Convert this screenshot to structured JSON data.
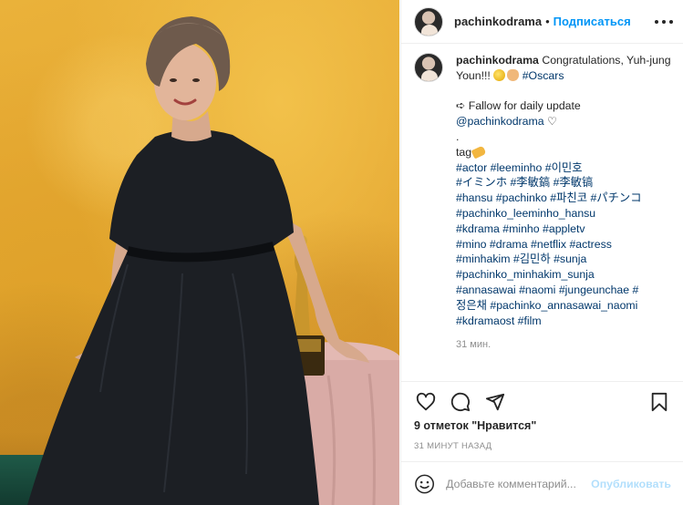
{
  "post": {
    "username": "pachinkodrama",
    "follow_label": "Подписаться",
    "header_separator": "•"
  },
  "caption": {
    "username": "pachinkodrama",
    "text_lead": "Congratulations, Yuh-jung Youn!!!",
    "oscars_tag": "#Oscars",
    "follow_line": "➪ Fallow for daily update",
    "mention": "@pachinkodrama",
    "heart": "♡",
    "dot_line": ".",
    "tag_word": "tag",
    "hashtag_lines": [
      [
        "#actor",
        "#leeminho",
        "#이민호"
      ],
      [
        "#イミンホ",
        "#李敏鎬",
        "#李敏镐"
      ],
      [
        "#hansu",
        "#pachinko",
        "#파친코",
        "#パチンコ"
      ],
      [
        "#pachinko_leeminho_hansu"
      ],
      [
        "#kdrama",
        "#minho",
        "#appletv"
      ],
      [
        "#mino",
        "#drama",
        "#netflix",
        "#actress"
      ],
      [
        "#minhakim",
        "#김민하",
        "#sunja"
      ],
      [
        "#pachinko_minhakim_sunja"
      ],
      [
        "#annasawai",
        "#naomi",
        "#jungeunchae",
        "#"
      ],
      [
        "정은채",
        "#pachinko_annasawai_naomi"
      ],
      [
        "#kdramaost",
        "#film"
      ]
    ],
    "time_ago": "31 мин."
  },
  "icons": {
    "more": "more-options-icon",
    "like": "heart-icon",
    "comment": "comment-icon",
    "share": "share-icon",
    "save": "bookmark-icon",
    "emoji": "emoji-icon"
  },
  "likes_text": "9 отметок \"Нравится\"",
  "posted_text": "31 МИНУТ НАЗАД",
  "comment_box": {
    "placeholder": "Добавьте комментарий...",
    "publish_label": "Опубликовать"
  },
  "colors": {
    "link": "#00376b",
    "follow": "#0095f6",
    "publish_disabled": "#b2dffc",
    "muted": "#8e8e8e"
  }
}
